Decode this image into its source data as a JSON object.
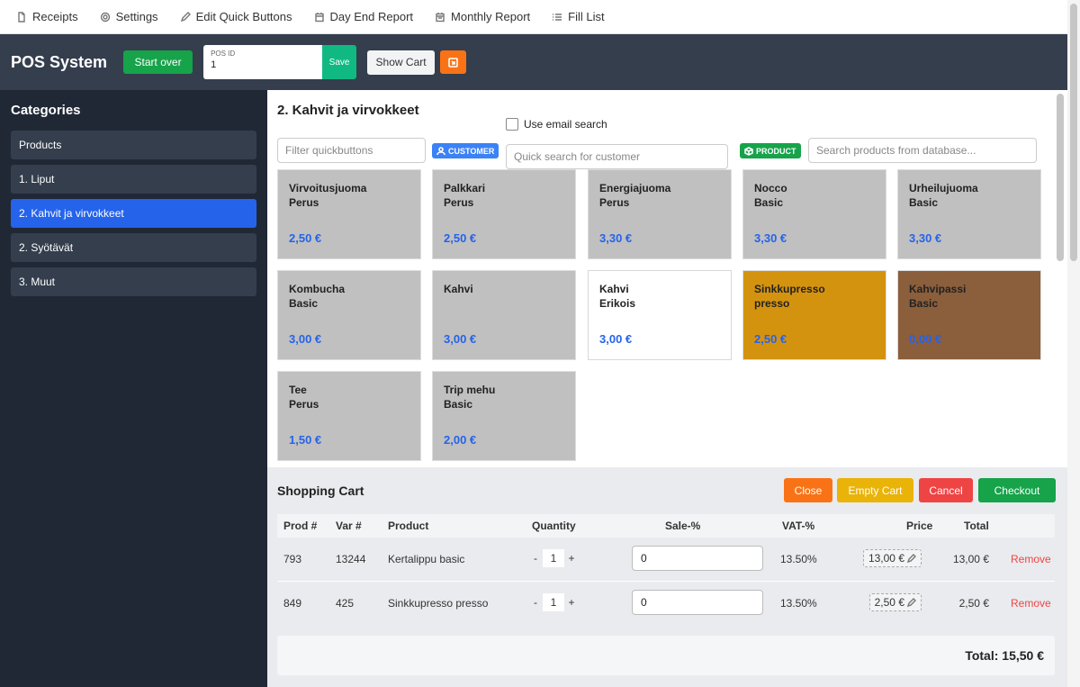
{
  "topnav": [
    {
      "label": "Receipts",
      "icon": "document-icon"
    },
    {
      "label": "Settings",
      "icon": "gear-icon"
    },
    {
      "label": "Edit Quick Buttons",
      "icon": "pencil-icon"
    },
    {
      "label": "Day End Report",
      "icon": "calendar-icon"
    },
    {
      "label": "Monthly Report",
      "icon": "calendar-report-icon"
    },
    {
      "label": "Fill List",
      "icon": "list-icon"
    }
  ],
  "header": {
    "title": "POS System",
    "start_over": "Start over",
    "pos_id_label": "POS ID",
    "pos_id_value": "1",
    "save": "Save",
    "show_cart": "Show Cart"
  },
  "sidebar": {
    "title": "Categories",
    "items": [
      "Products",
      "1. Liput",
      "2. Kahvit ja virvokkeet",
      "2. Syötävät",
      "3. Muut"
    ],
    "active_index": 2
  },
  "main": {
    "title": "2. Kahvit ja virvokkeet",
    "filter_placeholder": "Filter quickbuttons",
    "customer_badge": "CUSTOMER",
    "use_email_search": "Use email search",
    "customer_search_placeholder": "Quick search for customer",
    "product_badge": "PRODUCT",
    "product_search_placeholder": "Search products from database..."
  },
  "tiles": [
    {
      "line1": "Virvoitusjuoma",
      "line2": "Perus",
      "price": "2,50 €",
      "color": "#c0c0c0"
    },
    {
      "line1": "Palkkari",
      "line2": "Perus",
      "price": "2,50 €",
      "color": "#c0c0c0"
    },
    {
      "line1": "Energiajuoma",
      "line2": "Perus",
      "price": "3,30 €",
      "color": "#c0c0c0"
    },
    {
      "line1": "Nocco",
      "line2": "Basic",
      "price": "3,30 €",
      "color": "#c0c0c0"
    },
    {
      "line1": "Urheilujuoma",
      "line2": "Basic",
      "price": "3,30 €",
      "color": "#c0c0c0"
    },
    {
      "line1": "Kombucha",
      "line2": "Basic",
      "price": "3,00 €",
      "color": "#c0c0c0"
    },
    {
      "line1": "Kahvi",
      "line2": "",
      "price": "3,00 €",
      "color": "#c0c0c0"
    },
    {
      "line1": "Kahvi",
      "line2": "Erikois",
      "price": "3,00 €",
      "color": "#ffffff"
    },
    {
      "line1": "Sinkkupresso",
      "line2": "presso",
      "price": "2,50 €",
      "color": "#d4930f"
    },
    {
      "line1": "Kahvipassi",
      "line2": "Basic",
      "price": "0,00 €",
      "color": "#8b5e3c"
    },
    {
      "line1": "Tee",
      "line2": "Perus",
      "price": "1,50 €",
      "color": "#c0c0c0"
    },
    {
      "line1": "Trip mehu",
      "line2": "Basic",
      "price": "2,00 €",
      "color": "#c0c0c0"
    }
  ],
  "cart": {
    "title": "Shopping Cart",
    "close": "Close",
    "empty": "Empty Cart",
    "cancel": "Cancel",
    "checkout": "Checkout",
    "headers": {
      "prod": "Prod #",
      "var": "Var #",
      "product": "Product",
      "quantity": "Quantity",
      "sale": "Sale-%",
      "vat": "VAT-%",
      "price": "Price",
      "total": "Total"
    },
    "minus": "-",
    "plus": "+",
    "remove": "Remove",
    "rows": [
      {
        "prod": "793",
        "var": "13244",
        "product": "Kertalippu basic",
        "qty": "1",
        "sale": "0",
        "vat": "13.50%",
        "price": "13,00 €",
        "total": "13,00 €"
      },
      {
        "prod": "849",
        "var": "425",
        "product": "Sinkkupresso presso",
        "qty": "1",
        "sale": "0",
        "vat": "13.50%",
        "price": "2,50 €",
        "total": "2,50 €"
      }
    ],
    "total_label": "Total: 15,50 €"
  }
}
